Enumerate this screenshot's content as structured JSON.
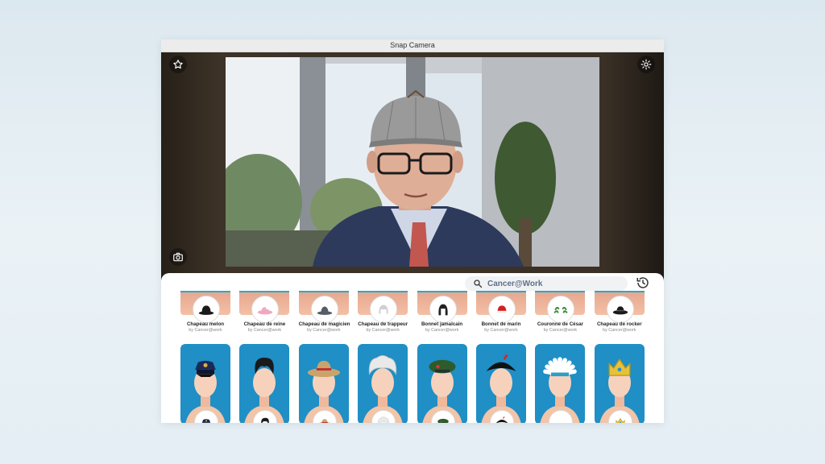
{
  "window": {
    "title": "Snap Camera"
  },
  "preview": {
    "favorite_icon": "star-icon",
    "settings_icon": "gear-icon",
    "snapshot_icon": "camera-icon"
  },
  "search": {
    "value": "Cancer@Work",
    "icon": "search-icon"
  },
  "history_icon": "history-icon",
  "lenses_row1": [
    {
      "name": "Chapeau melon",
      "author": "by Cancer@work",
      "hat": "bowler",
      "color": "#1a1a1a"
    },
    {
      "name": "Chapeau de reine",
      "author": "by Cancer@work",
      "hat": "queen",
      "color": "#f0a8c0"
    },
    {
      "name": "Chapeau de magicien",
      "author": "by Cancer@work",
      "hat": "magician",
      "color": "#555d66"
    },
    {
      "name": "Chapeau de trappeur",
      "author": "by Cancer@work",
      "hat": "trapper",
      "color": "#cfcfcf"
    },
    {
      "name": "Bonnet jamaïcain",
      "author": "by Cancer@work",
      "hat": "wig",
      "color": "#222222"
    },
    {
      "name": "Bonnet de marin",
      "author": "by Cancer@work",
      "hat": "sailor",
      "color": "#d61f1f"
    },
    {
      "name": "Couronne de César",
      "author": "by Cancer@work",
      "hat": "laurel",
      "color": "#3f8a3a"
    },
    {
      "name": "Chapeau de rocker",
      "author": "by Cancer@work",
      "hat": "rocker",
      "color": "#1a1a1a"
    }
  ],
  "lenses_row2": [
    {
      "hat": "police",
      "color": "#1b2a55"
    },
    {
      "hat": "elvis",
      "color": "#1a1a1a"
    },
    {
      "hat": "safari",
      "color": "#c9a46a"
    },
    {
      "hat": "einstein",
      "color": "#e9e9e9"
    },
    {
      "hat": "beret",
      "color": "#2e5b2c"
    },
    {
      "hat": "bicorne",
      "color": "#111111"
    },
    {
      "hat": "feathers",
      "color": "#ffffff"
    },
    {
      "hat": "crown",
      "color": "#e6c23a"
    }
  ]
}
